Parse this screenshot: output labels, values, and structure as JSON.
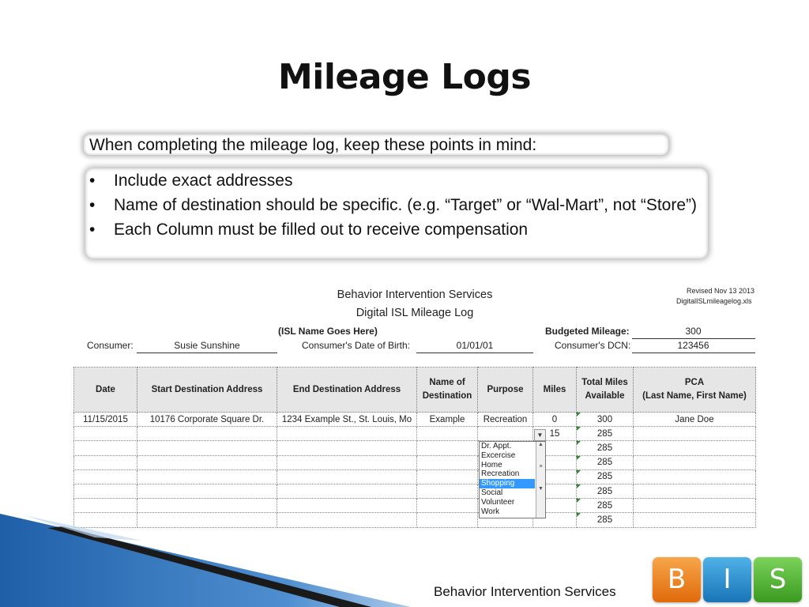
{
  "slide": {
    "title": "Mileage Logs",
    "intro": "When completing the mileage log, keep these points in mind:",
    "bullets": [
      "Include exact addresses",
      "Name of destination should be specific. (e.g. “Target” or “Wal-Mart”, not “Store”)",
      "Each Column must be filled out to receive compensation"
    ],
    "bullet_glyph": "•",
    "footer": "Behavior Intervention Services",
    "logo": {
      "b": "B",
      "i": "I",
      "s": "S"
    }
  },
  "sheet": {
    "header1": "Behavior Intervention Services",
    "header2": "Digital ISL Mileage Log",
    "revised": "Revised Nov 13 2013",
    "filename": "DigitalISLmileagelog.xls",
    "isl_name": "(ISL Name Goes Here)",
    "consumer_label": "Consumer:",
    "consumer_value": "Susie Sunshine",
    "dob_label": "Consumer's Date of Birth:",
    "dob_value": "01/01/01",
    "budget_label": "Budgeted Mileage:",
    "budget_value": "300",
    "dcn_label": "Consumer's DCN:",
    "dcn_value": "123456",
    "columns": [
      "Date",
      "Start Destination Address",
      "End Destination Address",
      "Name of Destination",
      "Purpose",
      "Miles",
      "Total Miles Available",
      "PCA\n(Last Name, First Name)"
    ],
    "rows": [
      [
        "11/15/2015",
        "10176 Corporate Square Dr.",
        "1234 Example St., St. Louis, Mo",
        "Example",
        "Recreation",
        "0",
        "300",
        "Jane Doe"
      ],
      [
        "",
        "",
        "",
        "",
        "",
        "15",
        "285",
        ""
      ],
      [
        "",
        "",
        "",
        "",
        "",
        "",
        "285",
        ""
      ],
      [
        "",
        "",
        "",
        "",
        "",
        "",
        "285",
        ""
      ],
      [
        "",
        "",
        "",
        "",
        "",
        "",
        "285",
        ""
      ],
      [
        "",
        "",
        "",
        "",
        "",
        "",
        "285",
        ""
      ],
      [
        "",
        "",
        "",
        "",
        "",
        "",
        "285",
        ""
      ],
      [
        "",
        "",
        "",
        "",
        "",
        "",
        "285",
        ""
      ]
    ],
    "purpose_options": [
      "Dr. Appt.",
      "Excercise",
      "Home",
      "Recreation",
      "Shopping",
      "Social",
      "Volunteer",
      "Work"
    ],
    "purpose_selected": "Shopping"
  },
  "colors": {
    "header_fill": "#e6e6e6",
    "selection": "#3399ff",
    "wedge_blue": "#1f5fa8",
    "logo_orange": "#f08c2a",
    "logo_blue": "#2a8fd0",
    "logo_green": "#55b83a"
  }
}
